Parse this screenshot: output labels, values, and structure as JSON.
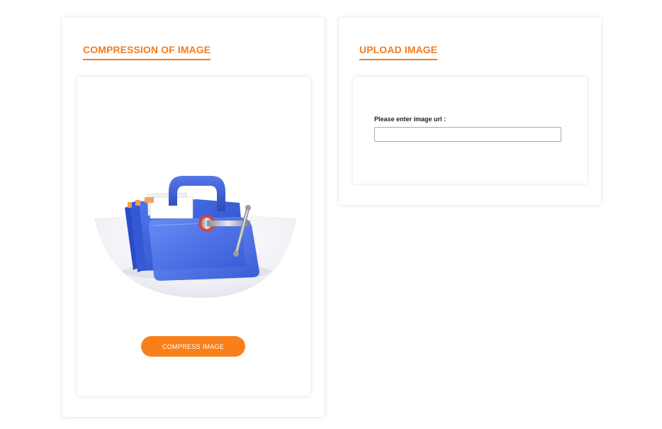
{
  "left_panel": {
    "title": "COMPRESSION OF IMAGE",
    "illustration_icon": "folder-clamp-icon",
    "compress_button_label": "COMPRESS IMAGE"
  },
  "right_panel": {
    "title": "UPLOAD IMAGE",
    "url_label": "Please enter image url :",
    "url_value": "",
    "url_placeholder": ""
  },
  "colors": {
    "accent": "#f47c20",
    "button": "#f97f1a",
    "folder_blue": "#3d6ae0"
  }
}
